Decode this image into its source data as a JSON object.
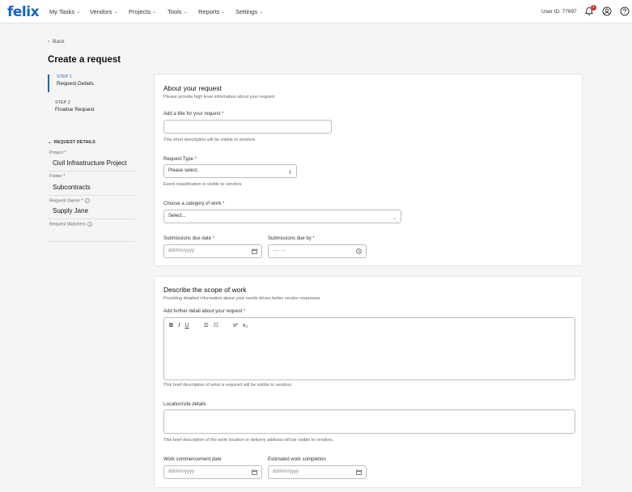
{
  "brand": {
    "logo": "felix",
    "accent": "#1565c0"
  },
  "nav": {
    "items": [
      "My Tasks",
      "Vendors",
      "Projects",
      "Tools",
      "Reports",
      "Settings"
    ],
    "user_id": "User ID: 77697",
    "notification_count": "1"
  },
  "back_label": "Back",
  "page_title": "Create a request",
  "steps": [
    {
      "num": "STEP 1",
      "label": "Request Details"
    },
    {
      "num": "STEP 2",
      "label": "Finalise Request"
    }
  ],
  "request_details": {
    "heading": "REQUEST DETAILS",
    "fields": [
      {
        "label": "Project",
        "value": "Civil Infrastructure Project"
      },
      {
        "label": "Folder",
        "value": "Subcontracts"
      },
      {
        "label": "Request Owner",
        "value": "Supply Jane"
      },
      {
        "label": "Request Watchers",
        "value": ""
      }
    ]
  },
  "about": {
    "title": "About your request",
    "subtitle": "Please provide high level information about your request",
    "title_label": "Add a title for your request",
    "title_helper": "This short description will be visible to vendors.",
    "type_label": "Request Type",
    "type_value": "Please select.",
    "type_helper": "Event classification is visible to vendors.",
    "category_label": "Choose a category of work",
    "category_value": "Select...",
    "due_date_label": "Submissions due date",
    "due_date_placeholder": "dd/mm/yyyy",
    "due_by_label": "Submissions due by",
    "due_by_placeholder": "--:-- --"
  },
  "scope": {
    "title": "Describe the scope of work",
    "subtitle": "Providing detailed information about your needs drives better vendor responses",
    "detail_label": "Add further detail about your request",
    "toolbar": [
      "B",
      "I",
      "U",
      "☰",
      "☷",
      "x²",
      "x₂"
    ],
    "detail_helper": "This brief description of what is required will be visible to vendors.",
    "location_label": "Location/site details",
    "location_helper": "This brief description of the work location or delivery address will be visible to vendors.",
    "commence_label": "Work commencement date",
    "commence_placeholder": "dd/mm/yyyy",
    "completion_label": "Estimated work completion",
    "completion_placeholder": "dd/mm/yyyy"
  }
}
